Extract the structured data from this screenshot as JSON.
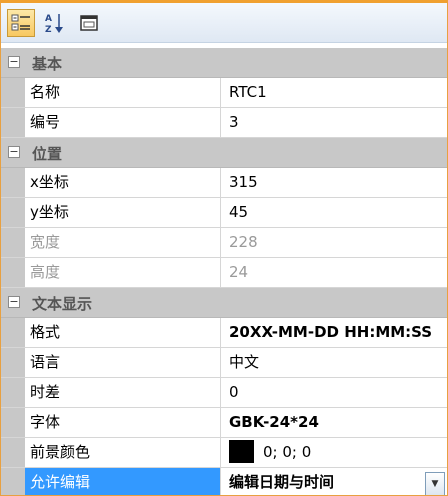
{
  "toolbar": {
    "buttons": [
      {
        "icon": "categorized-icon",
        "active": true
      },
      {
        "icon": "sort-az-icon",
        "active": false
      },
      {
        "icon": "property-pages-icon",
        "active": false
      }
    ]
  },
  "categories": {
    "basic": {
      "label": "基本",
      "toggle": "⊟"
    },
    "position": {
      "label": "位置",
      "toggle": "⊟"
    },
    "text_display": {
      "label": "文本显示",
      "toggle": "⊟"
    }
  },
  "properties": {
    "name": {
      "label": "名称",
      "value": "RTC1"
    },
    "number": {
      "label": "编号",
      "value": "3"
    },
    "x": {
      "label": "x坐标",
      "value": "315"
    },
    "y": {
      "label": "y坐标",
      "value": "45"
    },
    "width": {
      "label": "宽度",
      "value": "228"
    },
    "height": {
      "label": "高度",
      "value": "24"
    },
    "format": {
      "label": "格式",
      "value": "20XX-MM-DD HH:MM:SS"
    },
    "language": {
      "label": "语言",
      "value": "中文"
    },
    "time_offset": {
      "label": "时差",
      "value": "0"
    },
    "font": {
      "label": "字体",
      "value": "GBK-24*24"
    },
    "fg_color": {
      "label": "前景颜色",
      "value": "0; 0; 0",
      "swatch_color": "#000000"
    },
    "allow_edit": {
      "label": "允许编辑",
      "value": "编辑日期与时间"
    }
  },
  "colors": {
    "selection": "#3399ff",
    "category_bg": "#c8c8c8"
  }
}
